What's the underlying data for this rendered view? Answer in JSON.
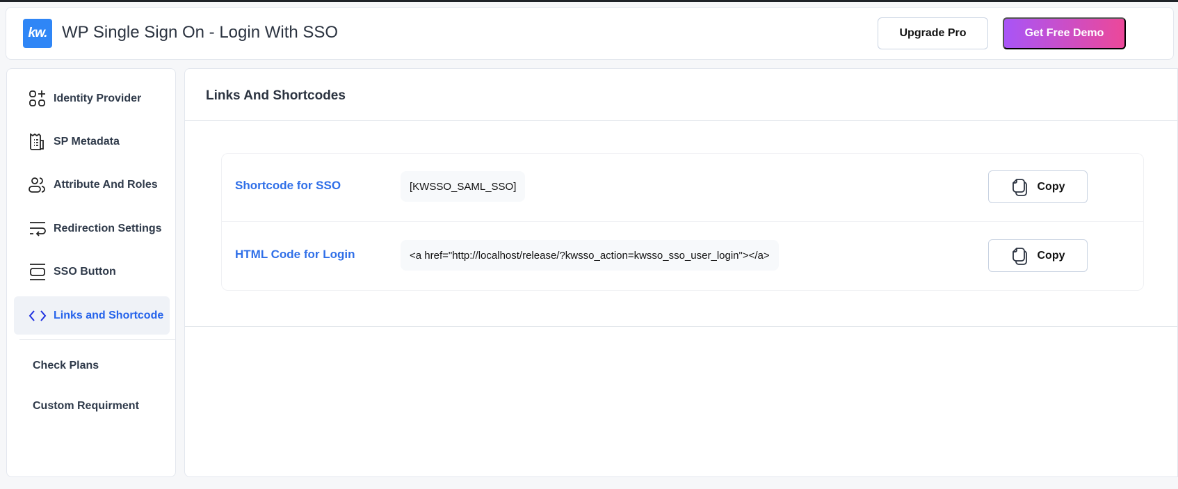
{
  "header": {
    "logo_text": "kw.",
    "title": "WP Single Sign On - Login With SSO",
    "upgrade_label": "Upgrade Pro",
    "demo_label": "Get Free Demo"
  },
  "sidebar": {
    "items": [
      {
        "label": "Identity Provider",
        "icon": "grid-plus-icon"
      },
      {
        "label": "SP Metadata",
        "icon": "receipt-icon"
      },
      {
        "label": "Attribute And Roles",
        "icon": "users-icon"
      },
      {
        "label": "Redirection Settings",
        "icon": "wrap-arrow-icon"
      },
      {
        "label": "SSO Button",
        "icon": "button-icon"
      },
      {
        "label": "Links and Shortcode",
        "icon": "code-icon",
        "active": true
      }
    ],
    "extra": [
      {
        "label": "Check Plans"
      },
      {
        "label": "Custom Requirment"
      }
    ]
  },
  "main": {
    "title": "Links And Shortcodes",
    "rows": [
      {
        "label": "Shortcode for SSO",
        "code": "[KWSSO_SAML_SSO]",
        "button": "Copy"
      },
      {
        "label": "HTML Code for Login",
        "code": "<a href=\"http://localhost/release/?kwsso_action=kwsso_sso_user_login\"></a>",
        "button": "Copy"
      }
    ]
  },
  "colors": {
    "accent": "#2563eb",
    "logo": "#2f86f6",
    "demo_start": "#a855f7",
    "demo_end": "#ec4899"
  }
}
